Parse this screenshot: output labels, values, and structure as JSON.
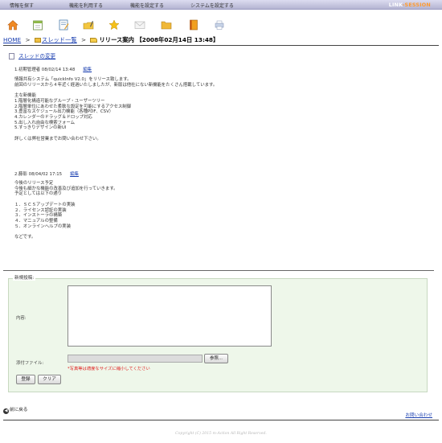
{
  "topmenu": {
    "items": [
      "情報を探す",
      "機能を利用する",
      "機能を設定する",
      "システムを設定する"
    ],
    "logo_main": "LINK",
    "logo_accent": "-SESSION"
  },
  "toolbar_icons": [
    "home-icon",
    "calendar-icon",
    "notepad-icon",
    "folder-pen-icon",
    "star-icon",
    "mail-icon",
    "folder-icon",
    "book-icon",
    "printer-icon"
  ],
  "breadcrumb": {
    "home": "HOME",
    "sep": ">",
    "threads": "スレッド一覧",
    "current": "リリース案内 【2008年02月14日 13:48】"
  },
  "thread": {
    "change_link": "スレッドの変更"
  },
  "posts": [
    {
      "meta": "1.初期管理者 08/02/14 13:48",
      "edit": "編集",
      "lines": [
        "情報共有システム「quickInfo V2.0」をリリース致します。",
        "前回のリリースから４年近く経過いたしましたが、新版は他社にない新機能をたくさん搭載しています。",
        "",
        "主な新機能",
        "1.階層化構造可能なグループ・ユーザーツリー",
        "2.階層単位にあわせた柔軟な設定を可能にするアクセス制御",
        "3.豊富なスケジュール出力機能（各種PDF、CSV）",
        "4.カレンダーのドラッグ＆ドロップ対応",
        "5.出し入れ自由な検索フォーム",
        "5.すっきりデザインの新UI",
        "",
        "詳しくは弊社営業までお問い合わせ下さい。"
      ]
    },
    {
      "meta": "2.藤影 08/04/02 17:15",
      "edit": "編集",
      "lines": [
        "今後のリリース予定",
        "今後も細かな機能の改善及び追加を行っていきます。",
        "予定としては以下の通り",
        "",
        "１．ＳＣＳアップデートの実装",
        "２．ライセンス認証の実装",
        "３．インストーラの構築",
        "４．マニュアルの整備",
        "５．オンラインヘルプの実装",
        "",
        "などです。"
      ]
    }
  ],
  "form": {
    "legend": "新規投稿:",
    "content_label": "内容:",
    "content_value": "",
    "file_label": "添付ファイル:",
    "browse_label": "参照...",
    "file_note": "*写真等は適度なサイズに縮小してください",
    "submit_label": "登録",
    "clear_label": "クリア"
  },
  "footer": {
    "back": "前に戻る",
    "contact": "お問い合わせ",
    "copyright": "Copyright (C) 2015 m-Action All Right Reserved."
  }
}
